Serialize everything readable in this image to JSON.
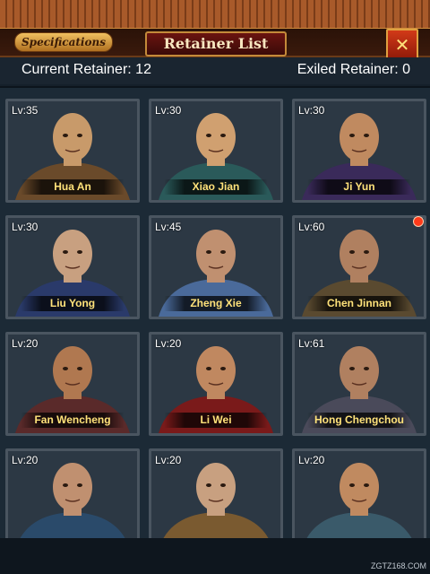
{
  "header": {
    "specifications_label": "Specifications",
    "title": "Retainer List",
    "close_symbol": "✕"
  },
  "counts": {
    "current_label": "Current Retainer: 12",
    "exiled_label": "Exiled Retainer: 0"
  },
  "retainers": [
    {
      "level": "Lv:35",
      "name": "Hua An",
      "robe": "#6a4a2a",
      "skin": "#c89a6a"
    },
    {
      "level": "Lv:30",
      "name": "Xiao Jian",
      "robe": "#2a5a5a",
      "skin": "#d0a070"
    },
    {
      "level": "Lv:30",
      "name": "Ji Yun",
      "robe": "#3a2a5a",
      "skin": "#c08a60"
    },
    {
      "level": "Lv:30",
      "name": "Liu Yong",
      "robe": "#2a3a6a",
      "skin": "#c8a080"
    },
    {
      "level": "Lv:45",
      "name": "Zheng Xie",
      "robe": "#4a6a9a",
      "skin": "#c09070"
    },
    {
      "level": "Lv:60",
      "name": "Chen Jinnan",
      "robe": "#5a4a30",
      "skin": "#b08060"
    },
    {
      "level": "Lv:20",
      "name": "Fan Wencheng",
      "robe": "#5a2a2a",
      "skin": "#b07850"
    },
    {
      "level": "Lv:20",
      "name": "Li Wei",
      "robe": "#7a1a1a",
      "skin": "#c08860"
    },
    {
      "level": "Lv:61",
      "name": "Hong Chengchou",
      "robe": "#4a4a5a",
      "skin": "#b08060"
    },
    {
      "level": "Lv:20",
      "name": "",
      "robe": "#2a4a6a",
      "skin": "#c09070"
    },
    {
      "level": "Lv:20",
      "name": "",
      "robe": "#7a5a30",
      "skin": "#c8a080"
    },
    {
      "level": "Lv:20",
      "name": "",
      "robe": "#3a5a6a",
      "skin": "#c08a60"
    }
  ],
  "watermark": "ZGTZ168.COM",
  "colors": {
    "accent_gold": "#ffe27a",
    "title_red": "#6a1410",
    "notification_red": "#ff3a1a"
  }
}
